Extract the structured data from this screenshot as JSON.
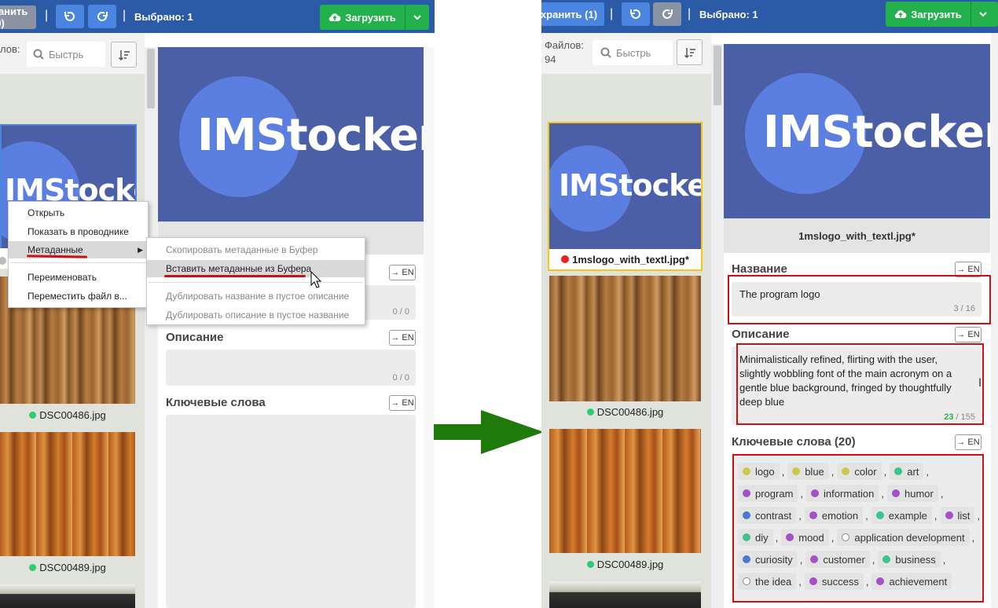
{
  "left": {
    "toolbar": {
      "save_label": "ранить (0)",
      "selected": "Выбрано: 1",
      "upload_label": "Загрузить"
    },
    "files_label": "лов:",
    "search_placeholder": "Быстрь",
    "thumbs": [
      {
        "name": "DSC00486.jpg",
        "status_color": "#2ecc71"
      },
      {
        "name": "DSC00489.jpg",
        "status_color": "#2ecc71"
      }
    ],
    "context_menu": {
      "items": [
        "Открыть",
        "Показать в проводнике",
        "Метаданные",
        "Переименовать",
        "Переместить файл в..."
      ],
      "submenu": [
        "Скопировать метаданные в Буфер",
        "Вставить метаданные из Буфера",
        "Дублировать название в пустое описание",
        "Дублировать описание в пустое название"
      ]
    },
    "detail": {
      "en_label": "→ EN",
      "title_counter": "0 / 0",
      "description_label": "Описание",
      "description_counter": "0 / 0",
      "keywords_label": "Ключевые слова"
    },
    "logo_text": "IMStocker"
  },
  "right": {
    "toolbar": {
      "save_label": "хранить (1)",
      "selected": "Выбрано: 1",
      "upload_label": "Загрузить"
    },
    "files_label": "Файлов:",
    "files_count": "94",
    "search_placeholder": "Быстрь",
    "thumbs": [
      {
        "name": "1mslogo_with_textl.jpg*",
        "status_color": "#e8231a"
      },
      {
        "name": "DSC00486.jpg",
        "status_color": "#2ecc71"
      },
      {
        "name": "DSC00489.jpg",
        "status_color": "#2ecc71"
      }
    ],
    "detail": {
      "filename": "1mslogo_with_textl.jpg*",
      "title_label": "Название",
      "title_value": "The program logo",
      "title_counter": "3 / 16",
      "description_label": "Описание",
      "description_value": "Minimalistically refined, flirting with the user, slightly wobbling font of the main acronym on a gentle blue background, fringed by thoughtfully deep blue",
      "description_counter_current": "23",
      "description_counter_total": "/ 155",
      "keywords_label": "Ключевые слова (20)",
      "en_label": "→ EN"
    },
    "logo_text": "IMStocker",
    "keywords": [
      [
        {
          "t": "logo",
          "c": "#c9c94a"
        },
        {
          "t": "blue",
          "c": "#c9c94a"
        },
        {
          "t": "color",
          "c": "#c9c94a"
        },
        {
          "t": "art",
          "c": "#3cc48c"
        }
      ],
      [
        {
          "t": "program",
          "c": "#a64fc9"
        },
        {
          "t": "information",
          "c": "#a64fc9"
        },
        {
          "t": "humor",
          "c": "#a64fc9"
        }
      ],
      [
        {
          "t": "contrast",
          "c": "#4a78d0"
        },
        {
          "t": "emotion",
          "c": "#a64fc9"
        },
        {
          "t": "example",
          "c": "#3cc48c"
        },
        {
          "t": "list",
          "c": "#a64fc9"
        }
      ],
      [
        {
          "t": "diy",
          "c": "#3cc48c"
        },
        {
          "t": "mood",
          "c": "#a64fc9"
        },
        {
          "t": "application development",
          "c": "none"
        }
      ],
      [
        {
          "t": "curiosity",
          "c": "#4a78d0"
        },
        {
          "t": "customer",
          "c": "#a64fc9"
        },
        {
          "t": "business",
          "c": "#3cc48c"
        }
      ],
      [
        {
          "t": "the idea",
          "c": "none"
        },
        {
          "t": "success",
          "c": "#a64fc9"
        },
        {
          "t": "achievement",
          "c": "#a64fc9"
        }
      ]
    ]
  }
}
